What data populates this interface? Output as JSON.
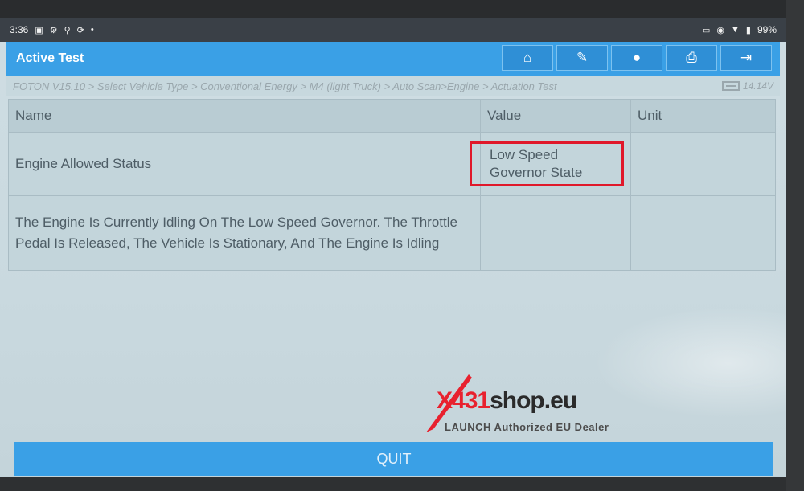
{
  "status_bar": {
    "time": "3:36",
    "battery": "99%"
  },
  "app": {
    "title": "Active Test"
  },
  "toolbar": {
    "buttons": [
      {
        "icon": "home-icon"
      },
      {
        "icon": "edit-icon"
      },
      {
        "icon": "chat-icon"
      },
      {
        "icon": "print-icon"
      },
      {
        "icon": "exit-icon"
      }
    ]
  },
  "breadcrumb": {
    "path": "FOTON V15.10 > Select Vehicle Type > Conventional Energy > M4 (light Truck) > Auto Scan>Engine > Actuation Test",
    "voltage": "14.14V"
  },
  "table": {
    "headers": {
      "name": "Name",
      "value": "Value",
      "unit": "Unit"
    },
    "rows": [
      {
        "name": "Engine Allowed Status",
        "value": "Low Speed Governor State",
        "unit": ""
      },
      {
        "name": "The Engine Is Currently Idling On The Low Speed Governor. The Throttle Pedal Is Released, The Vehicle Is Stationary, And The Engine Is Idling",
        "value": "",
        "unit": ""
      }
    ]
  },
  "watermark": {
    "brand_red": "X431",
    "brand_dark": "shop.eu",
    "tagline": "LAUNCH Authorized EU Dealer"
  },
  "quit_label": "QUIT",
  "colors": {
    "accent": "#3aa0e6",
    "highlight": "#e0182a"
  }
}
